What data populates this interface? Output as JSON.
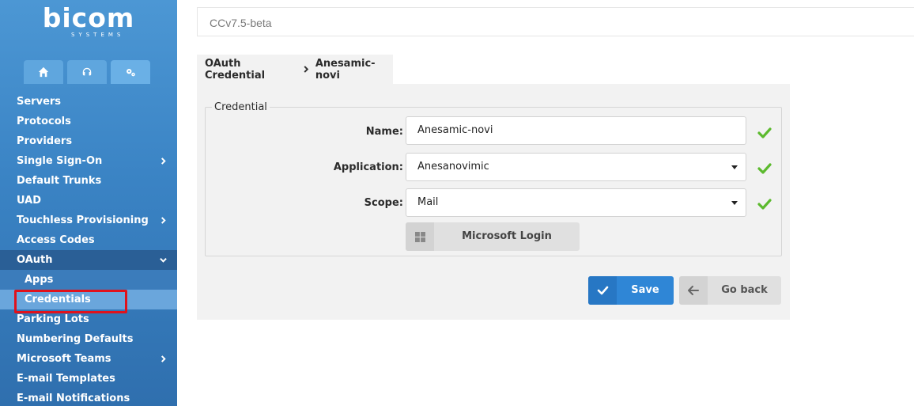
{
  "logo": {
    "main": "bicom",
    "sub": "SYSTEMS"
  },
  "top_tabs": [
    {
      "icon": "home-icon"
    },
    {
      "icon": "headset-icon"
    },
    {
      "icon": "gears-icon"
    }
  ],
  "sidebar": {
    "items": [
      {
        "label": "Servers"
      },
      {
        "label": "Protocols"
      },
      {
        "label": "Providers"
      },
      {
        "label": "Single Sign-On"
      },
      {
        "label": "Default Trunks"
      },
      {
        "label": "UAD"
      },
      {
        "label": "Touchless Provisioning"
      },
      {
        "label": "Access Codes"
      },
      {
        "label": "OAuth"
      },
      {
        "label": "Apps"
      },
      {
        "label": "Credentials"
      },
      {
        "label": "Parking Lots"
      },
      {
        "label": "Numbering Defaults"
      },
      {
        "label": "Microsoft Teams"
      },
      {
        "label": "E-mail Templates"
      },
      {
        "label": "E-mail Notifications"
      }
    ]
  },
  "header": {
    "version": "CCv7.5-beta"
  },
  "breadcrumb": {
    "parent": "OAuth Credential",
    "current": "Anesamic-novi"
  },
  "form": {
    "legend": "Credential",
    "name_label": "Name:",
    "name_value": "Anesamic-novi",
    "application_label": "Application:",
    "application_value": "Anesanovimic",
    "scope_label": "Scope:",
    "scope_value": "Mail",
    "microsoft_login_label": "Microsoft Login"
  },
  "actions": {
    "save_label": "Save",
    "back_label": "Go back"
  },
  "colors": {
    "sidebar": "#3a83c4",
    "primary": "#2f86d6",
    "valid": "#5cba2e",
    "highlight": "#e0121c"
  }
}
